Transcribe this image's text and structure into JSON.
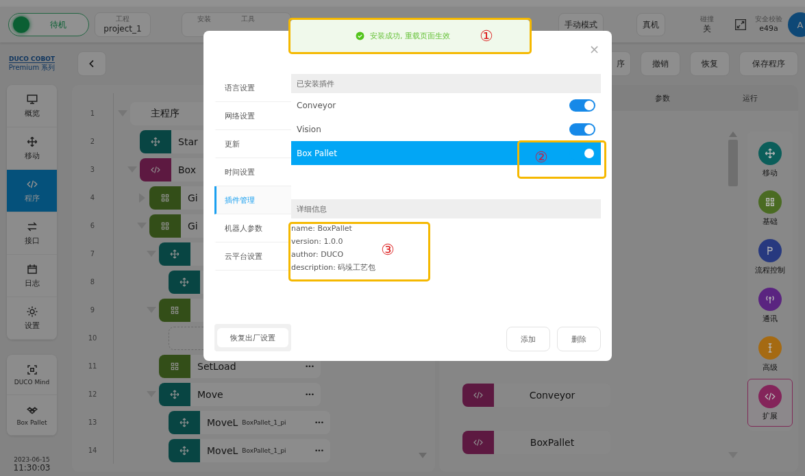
{
  "topbar": {
    "status": {
      "label": "待机"
    },
    "project": {
      "caption": "工程",
      "value": "project_1"
    },
    "install_captions": [
      "安装",
      "工具"
    ],
    "mode_button": "手动模式",
    "target_button": "真机",
    "collision": {
      "caption": "碰撞",
      "value": "关"
    },
    "safety": {
      "caption": "安全校验",
      "value": "e49a"
    },
    "avatar": "A"
  },
  "logo": {
    "brand": "DUCO COBOT",
    "series": "Premium 系列"
  },
  "nav": [
    {
      "label": "概览",
      "selected": false
    },
    {
      "label": "移动",
      "selected": false
    },
    {
      "label": "程序",
      "selected": true
    },
    {
      "label": "接口",
      "selected": false
    },
    {
      "label": "日志",
      "selected": false
    },
    {
      "label": "设置",
      "selected": false
    }
  ],
  "plugin_nav": [
    {
      "label": "DUCO Mind"
    },
    {
      "label": "Box Pallet"
    }
  ],
  "clock": {
    "date": "2023-06-15",
    "time": "11:30:03"
  },
  "toolbar": {
    "buttons": [
      "序",
      "撤销",
      "恢复",
      "保存程序"
    ]
  },
  "program_tree": [
    {
      "line": "1",
      "kind": "main",
      "label": "主程序",
      "expanded": true,
      "children": [
        {
          "line": "2",
          "kind": "move",
          "label": "Star"
        },
        {
          "line": "3",
          "kind": "script",
          "label": "Box",
          "expanded": true,
          "children": [
            {
              "line": "4",
              "kind": "basic",
              "label": "Gi",
              "expanded": false
            },
            {
              "line": "6",
              "kind": "basic",
              "label": "Gi",
              "expanded": true,
              "children": [
                {
                  "line": "7",
                  "kind": "move",
                  "expanded": true,
                  "children": [
                    {
                      "line": "8",
                      "kind": "move"
                    }
                  ]
                },
                {
                  "line": "9",
                  "kind": "basic",
                  "expanded": true,
                  "children": [
                    {
                      "line": "10",
                      "kind": "placeholder"
                    }
                  ]
                },
                {
                  "line": "11",
                  "kind": "basic",
                  "label": "SetLoad",
                  "menu": "•••"
                },
                {
                  "line": "12",
                  "kind": "move",
                  "label": "Move",
                  "menu": "•••",
                  "expanded": true,
                  "children": [
                    {
                      "line": "13",
                      "kind": "move",
                      "label": "MoveL",
                      "param": "BoxPallet_1_pi",
                      "menu": "•••"
                    },
                    {
                      "line": "14",
                      "kind": "move",
                      "label": "MoveL",
                      "param": "BoxPallet_1_pi",
                      "menu": "•••"
                    }
                  ]
                }
              ]
            }
          ]
        }
      ]
    }
  ],
  "detail_panel": {
    "columns": [
      "参数",
      "运行"
    ],
    "blocks": [
      {
        "label": "Conveyor"
      },
      {
        "label": "BoxPallet"
      }
    ]
  },
  "palette": [
    {
      "label": "移动",
      "color": "#0b5e5a",
      "selected": false
    },
    {
      "label": "基础",
      "color": "#4a6b22",
      "selected": false
    },
    {
      "label": "流程控制",
      "color": "#27397f",
      "selected": false
    },
    {
      "label": "通讯",
      "color": "#5a2480",
      "selected": false
    },
    {
      "label": "高级",
      "color": "#a56a12",
      "selected": false
    },
    {
      "label": "扩展",
      "color": "#84245a",
      "selected": true
    }
  ],
  "modal": {
    "close": "×",
    "menu": [
      {
        "label": "语言设置",
        "selected": false
      },
      {
        "label": "网络设置",
        "selected": false
      },
      {
        "label": "更新",
        "selected": false
      },
      {
        "label": "时间设置",
        "selected": false
      },
      {
        "label": "插件管理",
        "selected": true
      },
      {
        "label": "机器人参数",
        "selected": false
      },
      {
        "label": "云平台设置",
        "selected": false
      }
    ],
    "reset_button": "恢复出厂设置",
    "installed_heading": "已安装插件",
    "plugins": [
      {
        "name": "Conveyor",
        "on": true,
        "selected": false
      },
      {
        "name": "Vision",
        "on": true,
        "selected": false
      },
      {
        "name": "Box Pallet",
        "on": true,
        "selected": true
      }
    ],
    "details_heading": "详细信息",
    "details": [
      "name: BoxPallet",
      "version: 1.0.0",
      "author: DUCO",
      "description: 码垛工艺包"
    ],
    "buttons": [
      "添加",
      "删除"
    ]
  },
  "toast": {
    "message": "安装成功, 重载页面生效"
  },
  "annotations": [
    {
      "label": "①"
    },
    {
      "label": "②"
    },
    {
      "label": "③"
    }
  ]
}
